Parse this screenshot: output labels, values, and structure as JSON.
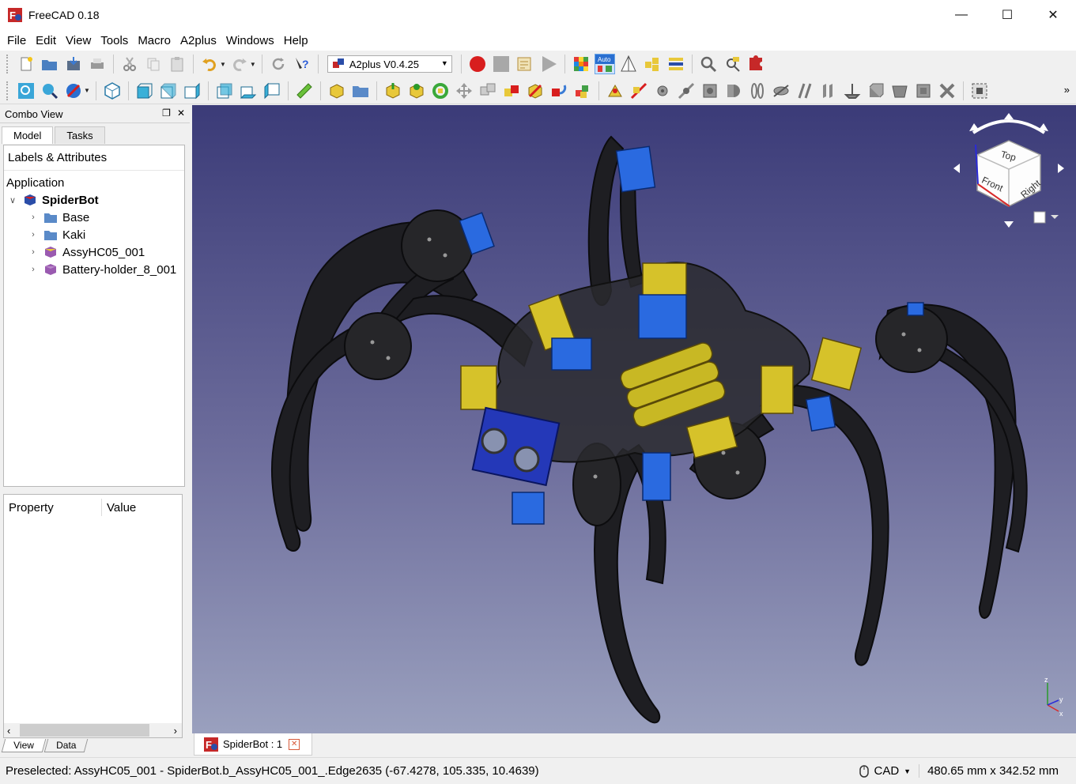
{
  "window": {
    "title": "FreeCAD 0.18"
  },
  "menu": [
    "File",
    "Edit",
    "View",
    "Tools",
    "Macro",
    "A2plus",
    "Windows",
    "Help"
  ],
  "toolbar": {
    "workbench": "A2plus V0.4.25",
    "auto_label": "Auto"
  },
  "combo_view": {
    "title": "Combo View",
    "tabs": [
      "Model",
      "Tasks"
    ],
    "tree_header": "Labels & Attributes",
    "root_label": "Application",
    "document": "SpiderBot",
    "items": [
      {
        "label": "Base",
        "icon": "folder-icon"
      },
      {
        "label": "Kaki",
        "icon": "folder-icon"
      },
      {
        "label": "AssyHC05_001",
        "icon": "part-icon"
      },
      {
        "label": "Battery-holder_8_001",
        "icon": "part-icon"
      }
    ],
    "property_columns": [
      "Property",
      "Value"
    ],
    "bottom_tabs": [
      "View",
      "Data"
    ]
  },
  "navcube": {
    "top": "Top",
    "front": "Front",
    "right": "Right"
  },
  "axis": {
    "x": "x",
    "y": "y",
    "z": "z"
  },
  "document_tab": {
    "label": "SpiderBot : 1"
  },
  "status": {
    "message": "Preselected: AssyHC05_001 - SpiderBot.b_AssyHC05_001_.Edge2635 (-67.4278, 105.335, 10.4639)",
    "nav_style": "CAD",
    "dimensions": "480.65 mm x 342.52 mm"
  },
  "colors": {
    "viewport_top": "#3b3b78",
    "viewport_bottom": "#9aa0be",
    "accent_red": "#d81e1e"
  }
}
